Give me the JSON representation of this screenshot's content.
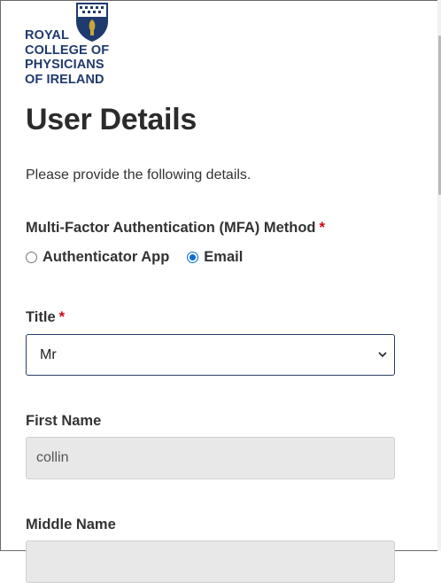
{
  "logo": {
    "lines": [
      "ROYAL",
      "COLLEGE OF",
      "PHYSICIANS",
      "OF IRELAND"
    ],
    "brand_color": "#1f3a6e"
  },
  "page": {
    "title": "User Details",
    "intro": "Please provide the following details."
  },
  "mfa": {
    "label": "Multi-Factor Authentication (MFA) Method",
    "required_mark": "*",
    "options": [
      {
        "label": "Authenticator App",
        "selected": false
      },
      {
        "label": "Email",
        "selected": true
      }
    ]
  },
  "title_field": {
    "label": "Title",
    "required_mark": "*",
    "value": "Mr"
  },
  "first_name": {
    "label": "First Name",
    "value": "collin"
  },
  "middle_name": {
    "label": "Middle Name",
    "value": ""
  },
  "colors": {
    "required": "#d0021b",
    "radio_selected": "#0b6bd6",
    "disabled_input": "#e8e8e8"
  }
}
